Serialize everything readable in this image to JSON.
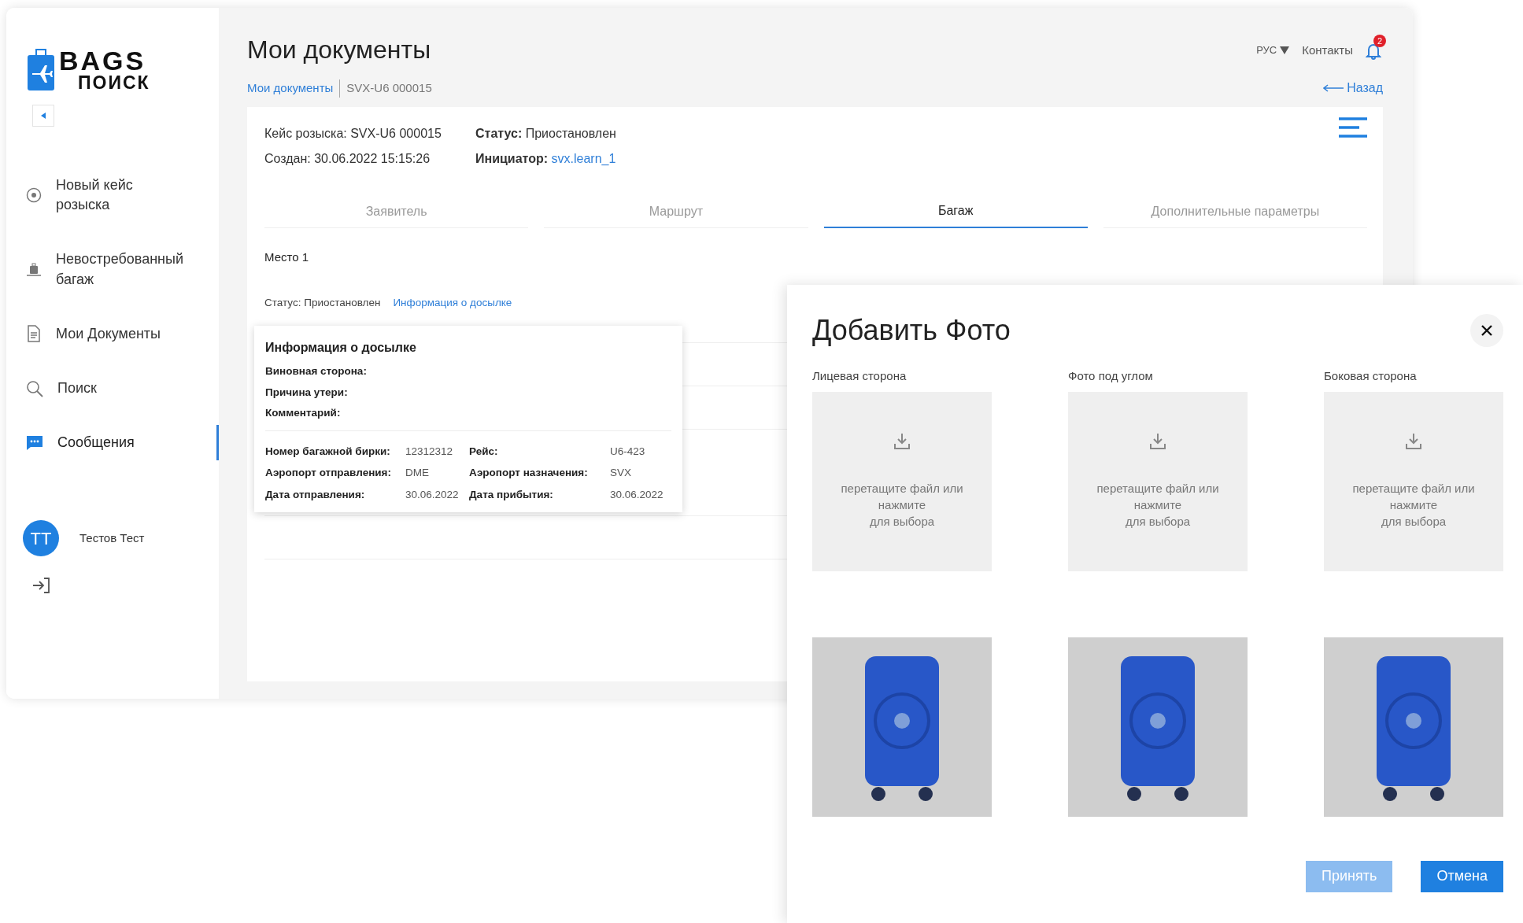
{
  "sidebar": {
    "logo": {
      "title": "BAGS",
      "subtitle": "ПОИСК"
    },
    "items": [
      {
        "label": "Новый кейс розыска",
        "selected": false
      },
      {
        "label": "Невостребованный багаж",
        "selected": false
      },
      {
        "label": "Мои Документы",
        "selected": false
      },
      {
        "label": "Поиск",
        "selected": false
      },
      {
        "label": "Сообщения",
        "selected": true
      }
    ],
    "user": {
      "initials": "ТТ",
      "name": "Тестов Тест"
    }
  },
  "header": {
    "title": "Мои документы",
    "language": "РУС",
    "contacts": "Контакты",
    "notifications": "2",
    "breadcrumb": [
      {
        "label": "Мои документы",
        "kind": "link"
      },
      {
        "label": "SVX-U6 000015",
        "kind": "current"
      }
    ],
    "back": "Назад"
  },
  "case_info": [
    {
      "text": "Кейс розыска: SVX-U6 000015"
    },
    {
      "text": "Создан: 30.06.2022 15:15:26"
    },
    {
      "text": "**Статус:** Приостановлен"
    },
    {
      "label": "Инициатор:",
      "link": "svx.learn_1"
    }
  ],
  "tabs": [
    {
      "label": "Заявитель",
      "selected": false
    },
    {
      "label": "Маршрут",
      "selected": false
    },
    {
      "label": "Багаж",
      "selected": true
    },
    {
      "label": "Дополнительные параметры",
      "selected": false
    }
  ],
  "place": "Место 1",
  "place_status": "Статус: Приостановлен",
  "forwarding_link": "Информация о досылке",
  "popover": {
    "title": "Информация о досылке",
    "lines": [
      "Виновная сторона:",
      "Причина утери:",
      "Комментарий:"
    ],
    "rows": [
      [
        "Номер багажной бирки:",
        "12312312",
        "Рейс:",
        "U6-423"
      ],
      [
        "Аэропорт отправления:",
        "DME",
        "Аэропорт назначения:",
        "SVX"
      ],
      [
        "Дата отправления:",
        "30.06.2022",
        "Дата прибытия:",
        "30.06.2022"
      ]
    ]
  },
  "modal": {
    "title": "Добавить Фото",
    "uploads": [
      {
        "label": "Лицевая сторона",
        "hint": "перетащите файл или\nнажмите\nдля выбора",
        "photo": true
      },
      {
        "label": "Фото под углом",
        "hint": "перетащите файл или\nнажмите\nдля выбора",
        "photo": true
      },
      {
        "label": "Боковая сторона",
        "hint": "перетащите файл или\nнажмите\nдля выбора",
        "photo": true
      }
    ],
    "buttons": [
      {
        "label": "Принять",
        "disabled": true
      },
      {
        "label": "Отмена",
        "disabled": false
      }
    ]
  }
}
